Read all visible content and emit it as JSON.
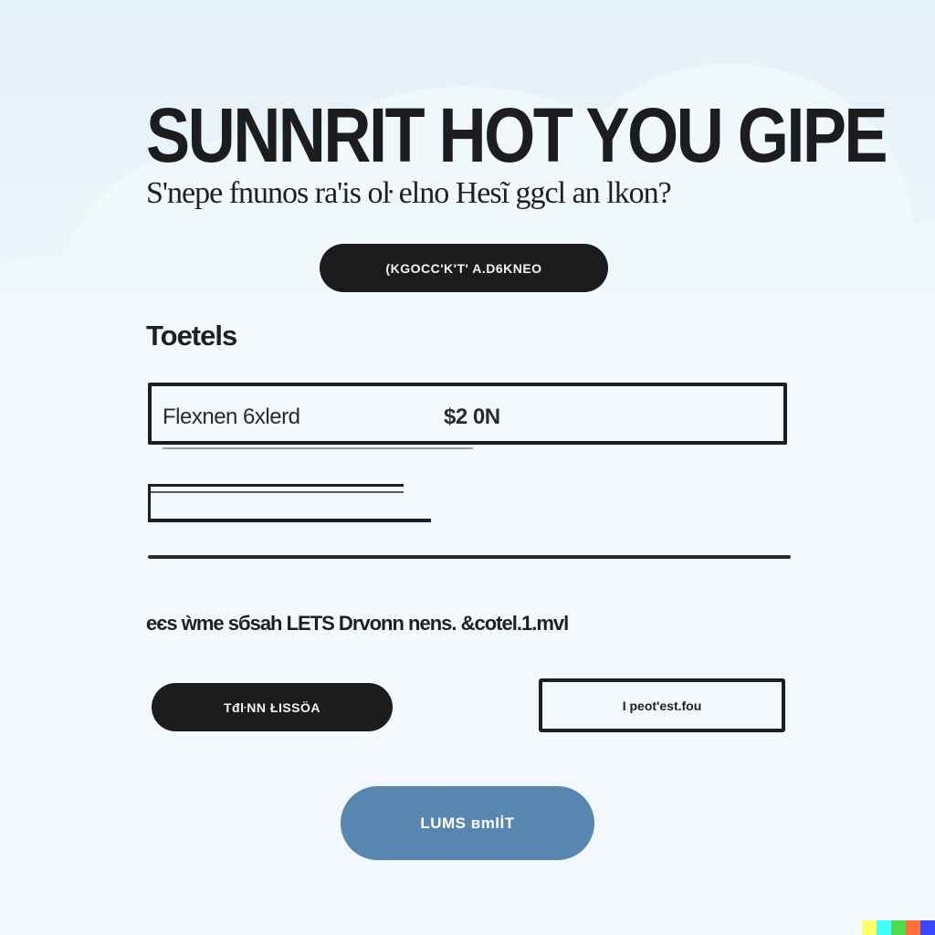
{
  "hero": {
    "title": "SUNNRIT HOT YOU GIPE",
    "subtitle": "S'nepe fnunos ra'is oŀ elno Hesĩ ggcl an lkon?"
  },
  "top_button": {
    "label": "(KGOCC'K'T' A.D6KNEO"
  },
  "section": {
    "title": "Toetels"
  },
  "field": {
    "label": "Flexnen 6xlerd",
    "value": "$2 0N"
  },
  "note": {
    "text": "eєs ẁme sбsah LETS Drvonn nens. &cotel.1.mvl"
  },
  "secondary_buttons": {
    "left_label": "TđŀNN ŁISSÖA",
    "right_label": "I рeot'est.fou"
  },
  "primary_button": {
    "label": "LUMS вmlİT"
  },
  "colors": {
    "dark_button": "#1c1b1d",
    "primary_button": "#5787b0",
    "background": "#f2f8fb",
    "strip": [
      "#ffff66",
      "#42ffff",
      "#51da4c",
      "#ff6e3c",
      "#3c46ff"
    ]
  }
}
